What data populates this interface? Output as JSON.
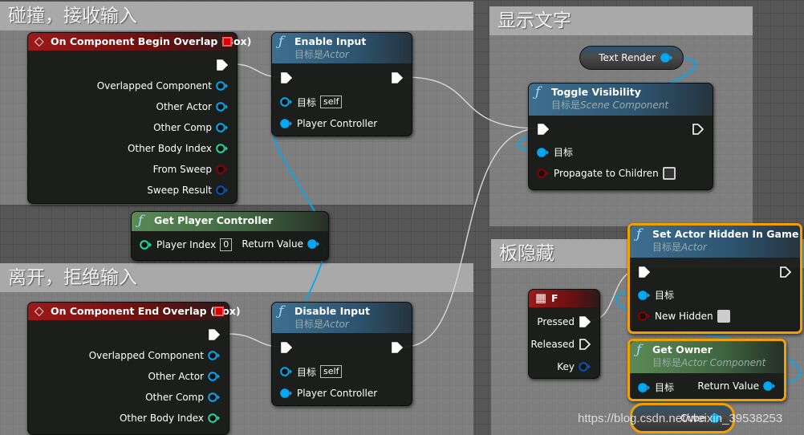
{
  "colors": {
    "object": "#00a8f4",
    "int": "#1ed9a0",
    "bool": "#8c0000",
    "struct": "#0a52b8",
    "exec": "#ffffff",
    "selection": "#f0a000"
  },
  "comments": [
    {
      "id": "c1",
      "title": "碰撞，接收输入"
    },
    {
      "id": "c2",
      "title": "离开，拒绝输入"
    },
    {
      "id": "c3",
      "title": "显示文字"
    },
    {
      "id": "c4",
      "title": "板隐藏"
    }
  ],
  "nodes": [
    {
      "id": "begin",
      "icon": "event-diamond-icon",
      "style": "red",
      "title": "On Component Begin Overlap (Box)",
      "rows": [
        {
          "r": {
            "kind": "exec",
            "filled": true
          }
        },
        {
          "r": {
            "label": "Overlapped Component",
            "type": "object"
          }
        },
        {
          "r": {
            "label": "Other Actor",
            "type": "object"
          }
        },
        {
          "r": {
            "label": "Other Comp",
            "type": "object"
          }
        },
        {
          "r": {
            "label": "Other Body Index",
            "type": "int"
          }
        },
        {
          "r": {
            "label": "From Sweep",
            "type": "bool"
          }
        },
        {
          "r": {
            "label": "Sweep Result",
            "type": "struct"
          }
        }
      ]
    },
    {
      "id": "enable",
      "icon": "function-icon",
      "style": "blue",
      "title": "Enable Input",
      "subtitle_prefix": "目标是",
      "subtitle": "Actor",
      "rows": [
        {
          "l": {
            "kind": "exec",
            "filled": true
          },
          "r": {
            "kind": "exec",
            "filled": true
          }
        },
        {
          "l": {
            "label": "目标",
            "type": "object",
            "default": "self"
          }
        },
        {
          "l": {
            "label": "Player Controller",
            "type": "object",
            "filled": true
          }
        }
      ]
    },
    {
      "id": "gpc",
      "icon": "function-icon",
      "style": "green",
      "title": "Get Player Controller",
      "rows": [
        {
          "l": {
            "label": "Player Index",
            "type": "int",
            "default": "0"
          },
          "r": {
            "label": "Return Value",
            "type": "object",
            "filled": true
          }
        }
      ]
    },
    {
      "id": "end",
      "icon": "event-diamond-icon",
      "style": "red",
      "title": "On Component End Overlap (Box)",
      "rows": [
        {
          "r": {
            "kind": "exec",
            "filled": true
          }
        },
        {
          "r": {
            "label": "Overlapped Component",
            "type": "object"
          }
        },
        {
          "r": {
            "label": "Other Actor",
            "type": "object"
          }
        },
        {
          "r": {
            "label": "Other Comp",
            "type": "object"
          }
        },
        {
          "r": {
            "label": "Other Body Index",
            "type": "int"
          }
        }
      ]
    },
    {
      "id": "disable",
      "icon": "function-icon",
      "style": "blue",
      "title": "Disable Input",
      "subtitle_prefix": "目标是",
      "subtitle": "Actor",
      "rows": [
        {
          "l": {
            "kind": "exec",
            "filled": true
          },
          "r": {
            "kind": "exec",
            "filled": true
          }
        },
        {
          "l": {
            "label": "目标",
            "type": "object",
            "default": "self"
          }
        },
        {
          "l": {
            "label": "Player Controller",
            "type": "object",
            "filled": true
          }
        }
      ]
    },
    {
      "id": "toggle",
      "icon": "function-icon",
      "style": "blue",
      "title": "Toggle Visibility",
      "subtitle_prefix": "目标是",
      "subtitle": "Scene Component",
      "rows": [
        {
          "l": {
            "kind": "exec",
            "filled": true
          },
          "r": {
            "kind": "exec",
            "filled": false
          }
        },
        {
          "l": {
            "label": "目标",
            "type": "object",
            "filled": true
          }
        },
        {
          "l": {
            "label": "Propagate to Children",
            "type": "bool",
            "checkbox": false
          }
        }
      ]
    },
    {
      "id": "fkey",
      "icon": "keyboard-icon",
      "style": "red",
      "title": "F",
      "rows": [
        {
          "r": {
            "label": "Pressed",
            "kind": "exec",
            "filled": true
          }
        },
        {
          "r": {
            "label": "Released",
            "kind": "exec",
            "filled": false
          }
        },
        {
          "r": {
            "label": "Key",
            "type": "struct"
          }
        }
      ]
    },
    {
      "id": "hidden",
      "icon": "function-icon",
      "style": "blue",
      "selected": true,
      "title": "Set Actor Hidden In Game",
      "subtitle_prefix": "目标是",
      "subtitle": "Actor",
      "rows": [
        {
          "l": {
            "kind": "exec",
            "filled": true
          },
          "r": {
            "kind": "exec",
            "filled": false
          }
        },
        {
          "l": {
            "label": "目标",
            "type": "object",
            "filled": true
          }
        },
        {
          "l": {
            "label": "New Hidden",
            "type": "bool",
            "checkbox": true
          }
        }
      ]
    },
    {
      "id": "owner",
      "icon": "function-icon",
      "style": "green",
      "selected": true,
      "title": "Get Owner",
      "subtitle_prefix": "目标是",
      "subtitle": "Actor Component",
      "rows": [
        {
          "l": {
            "label": "目标",
            "type": "object",
            "filled": true
          },
          "r": {
            "label": "Return Value",
            "type": "object",
            "filled": true
          }
        }
      ]
    }
  ],
  "variables": [
    {
      "id": "textrender",
      "label": "Text Render",
      "type": "object"
    },
    {
      "id": "cube",
      "label": "Cube",
      "type": "object",
      "selected": true
    }
  ],
  "watermark": "https://blog.csdn.net/weixin_39538253"
}
